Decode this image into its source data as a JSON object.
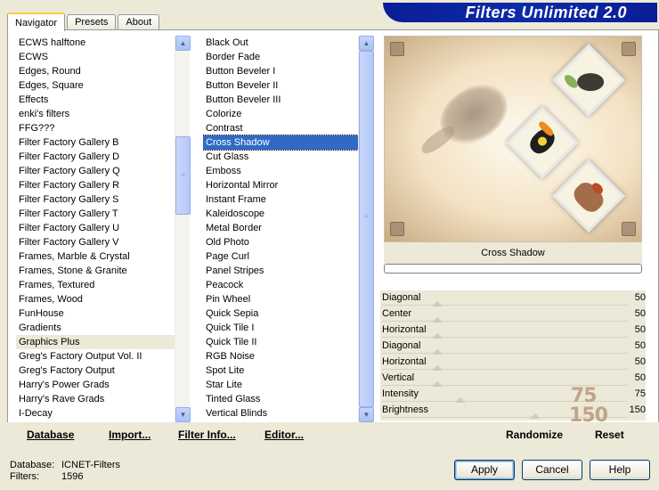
{
  "tabs": [
    {
      "label": "Navigator",
      "active": true
    },
    {
      "label": "Presets",
      "active": false
    },
    {
      "label": "About",
      "active": false
    }
  ],
  "banner": {
    "title": "Filters Unlimited 2.0"
  },
  "categories": {
    "items": [
      "ECWS halftone",
      "ECWS",
      "Edges, Round",
      "Edges, Square",
      "Effects",
      "enki's filters",
      "FFG???",
      "Filter Factory Gallery B",
      "Filter Factory Gallery D",
      "Filter Factory Gallery Q",
      "Filter Factory Gallery R",
      "Filter Factory Gallery S",
      "Filter Factory Gallery T",
      "Filter Factory Gallery U",
      "Filter Factory Gallery V",
      "Frames, Marble & Crystal",
      "Frames, Stone & Granite",
      "Frames, Textured",
      "Frames, Wood",
      "FunHouse",
      "Gradients",
      "Graphics Plus",
      "Greg's Factory Output Vol. II",
      "Greg's Factory Output",
      "Harry's Power Grads",
      "Harry's Rave Grads",
      "I-Decay"
    ],
    "selected": "Graphics Plus"
  },
  "filters": {
    "items": [
      "Black Out",
      "Border Fade",
      "Button Beveler I",
      "Button Beveler II",
      "Button Beveler III",
      "Colorize",
      "Contrast",
      "Cross Shadow",
      "Cut Glass",
      "Emboss",
      "Horizontal Mirror",
      "Instant Frame",
      "Kaleidoscope",
      "Metal Border",
      "Old Photo",
      "Page Curl",
      "Panel Stripes",
      "Peacock",
      "Pin Wheel",
      "Quick Sepia",
      "Quick Tile I",
      "Quick Tile II",
      "RGB Noise",
      "Spot Lite",
      "Star Lite",
      "Tinted Glass",
      "Vertical Blinds"
    ],
    "selected": "Cross Shadow"
  },
  "preview": {
    "filter_name": "Cross Shadow"
  },
  "sliders": [
    {
      "label": "Diagonal",
      "value": "50",
      "level": 0.23
    },
    {
      "label": "Center",
      "value": "50",
      "level": 0.23
    },
    {
      "label": "Horizontal",
      "value": "50",
      "level": 0.23
    },
    {
      "label": "Diagonal",
      "value": "50",
      "level": 0.23
    },
    {
      "label": "Horizontal",
      "value": "50",
      "level": 0.23
    },
    {
      "label": "Vertical",
      "value": "50",
      "level": 0.23
    },
    {
      "label": "Intensity",
      "value": "75",
      "level": 0.33
    },
    {
      "label": "Brightness",
      "value": "150",
      "level": 0.64
    }
  ],
  "overlay_values": {
    "intensity": "75",
    "brightness": "150"
  },
  "links": {
    "database": "Database",
    "import": "Import...",
    "filter_info": "Filter Info...",
    "editor": "Editor...",
    "randomize": "Randomize",
    "reset": "Reset"
  },
  "status": {
    "database_label": "Database:",
    "database_value": "ICNET-Filters",
    "filters_label": "Filters:",
    "filters_value": "1596"
  },
  "buttons": {
    "apply": "Apply",
    "cancel": "Cancel",
    "help": "Help"
  }
}
